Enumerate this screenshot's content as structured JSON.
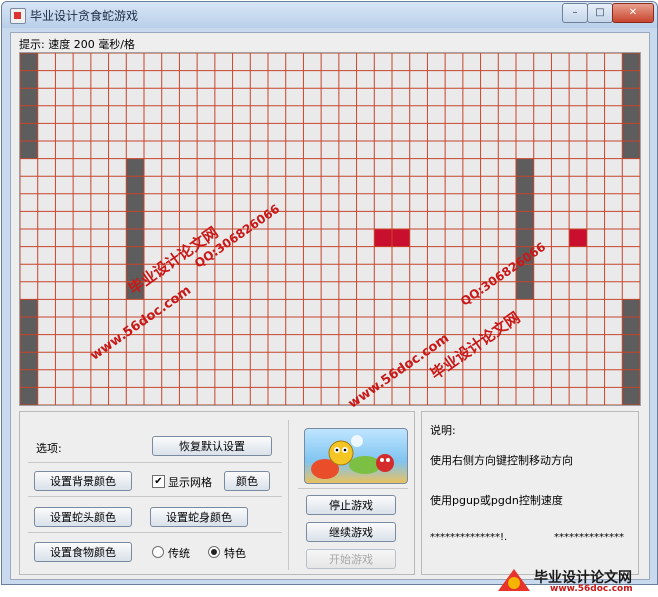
{
  "window": {
    "title": "毕业设计贪食蛇游戏",
    "controls": [
      "–",
      "□",
      "✕"
    ]
  },
  "hint": "提示: 速度 200 毫秒/格",
  "board": {
    "cols": 35,
    "rows": 20,
    "background": "#eaeaea",
    "grid_color": "#c8442c",
    "wall_color": "#5d5d5d",
    "food_color": "#c8102e",
    "walls": [
      [
        0,
        0
      ],
      [
        0,
        1
      ],
      [
        0,
        2
      ],
      [
        0,
        3
      ],
      [
        0,
        4
      ],
      [
        0,
        5
      ],
      [
        34,
        0
      ],
      [
        34,
        1
      ],
      [
        34,
        2
      ],
      [
        34,
        3
      ],
      [
        34,
        4
      ],
      [
        34,
        5
      ],
      [
        6,
        6
      ],
      [
        6,
        7
      ],
      [
        6,
        8
      ],
      [
        6,
        9
      ],
      [
        6,
        10
      ],
      [
        6,
        11
      ],
      [
        6,
        12
      ],
      [
        6,
        13
      ],
      [
        28,
        6
      ],
      [
        28,
        7
      ],
      [
        28,
        8
      ],
      [
        28,
        9
      ],
      [
        28,
        10
      ],
      [
        28,
        11
      ],
      [
        28,
        12
      ],
      [
        28,
        13
      ],
      [
        0,
        14
      ],
      [
        0,
        15
      ],
      [
        0,
        16
      ],
      [
        0,
        17
      ],
      [
        0,
        18
      ],
      [
        0,
        19
      ],
      [
        34,
        14
      ],
      [
        34,
        15
      ],
      [
        34,
        16
      ],
      [
        34,
        17
      ],
      [
        34,
        18
      ],
      [
        34,
        19
      ]
    ],
    "food": [
      [
        20,
        10
      ],
      [
        21,
        10
      ],
      [
        31,
        10
      ]
    ]
  },
  "options": {
    "title": "选项:",
    "reset_button": "恢复默认设置",
    "bg_color_button": "设置背景颜色",
    "show_grid_label": "显示网格",
    "show_grid_checked": true,
    "color_button": "颜色",
    "head_color_button": "设置蛇头颜色",
    "body_color_button": "设置蛇身颜色",
    "food_color_button": "设置食物颜色",
    "radio_traditional": "传统",
    "radio_special": "特色",
    "selected_style": "特色"
  },
  "controls": {
    "stop_button": "停止游戏",
    "continue_button": "继续游戏",
    "start_button": "开始游戏"
  },
  "info": {
    "title": "说明:",
    "line1": "使用右侧方向键控制移动方向",
    "line2": "使用pgup或pgdn控制速度",
    "stars_left": "**************!.",
    "stars_right": "**************"
  },
  "watermarks": {
    "site_cn": "毕业设计论文网",
    "qq": "QQ:306826066",
    "url": "www.56doc.com",
    "footer_url": "www.56doc.com"
  }
}
